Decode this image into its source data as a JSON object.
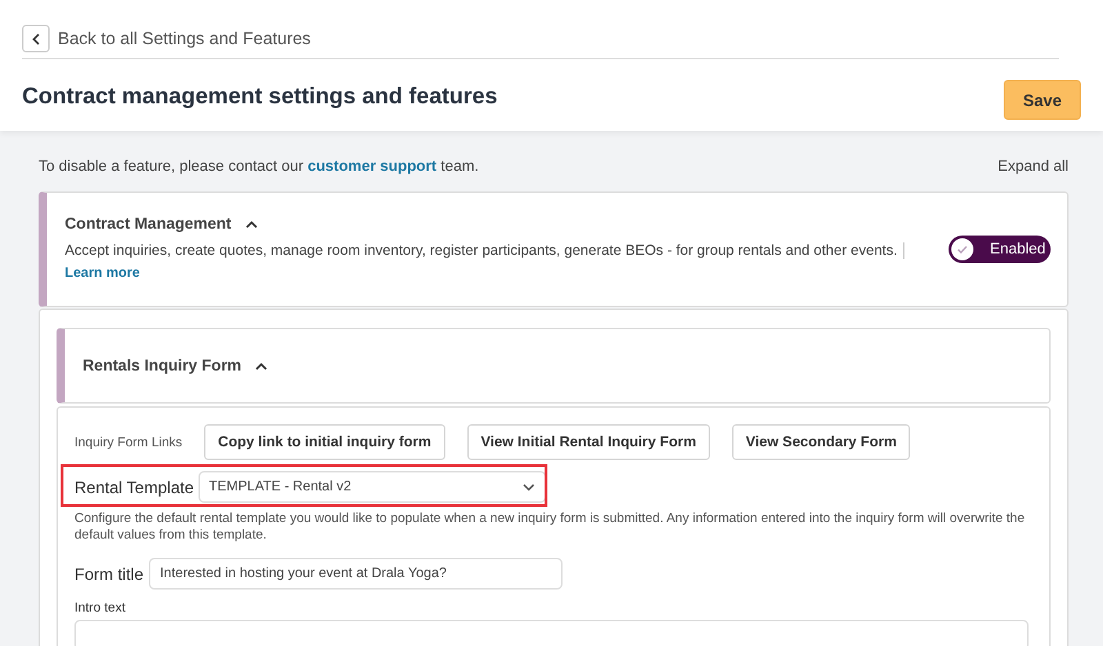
{
  "header": {
    "back_link": "Back to all Settings and Features",
    "title": "Contract management settings and features",
    "save_button": "Save"
  },
  "notice": {
    "before": "To disable a feature, please contact our ",
    "link": "customer support",
    "after": " team.",
    "expand_all": "Expand all"
  },
  "feature": {
    "title": "Contract Management",
    "expanded": true,
    "description": "Accept inquiries, create quotes, manage room inventory, register participants, generate BEOs - for group rentals and other events.",
    "learn_more": "Learn more",
    "toggle": {
      "label": "Enabled",
      "on": true
    }
  },
  "section": {
    "title": "Rentals Inquiry Form",
    "expanded": true,
    "links_label": "Inquiry Form Links",
    "link_buttons": [
      "Copy link to initial inquiry form",
      "View Initial Rental Inquiry Form",
      "View Secondary Form"
    ],
    "rental_template": {
      "label": "Rental Template",
      "value": "TEMPLATE - Rental v2",
      "highlighted": true,
      "help": "Configure the default rental template you would like to populate when a new inquiry form is submitted. Any information entered into the inquiry form will overwrite the default values from this template."
    },
    "form_title": {
      "label": "Form title",
      "value": "Interested in hosting your event at Drala Yoga?"
    },
    "intro_text": {
      "label": "Intro text"
    }
  }
}
